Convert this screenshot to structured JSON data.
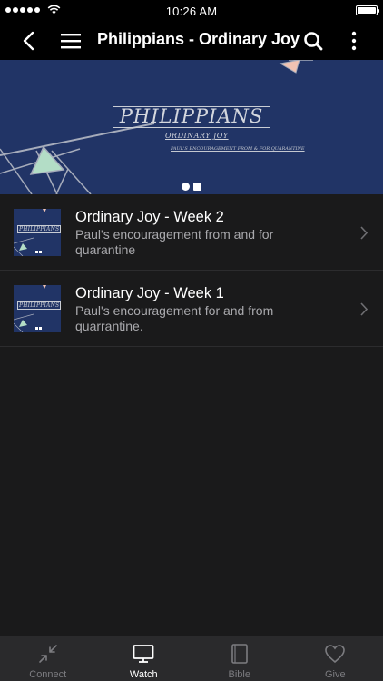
{
  "status_bar": {
    "time": "10:26 AM"
  },
  "nav": {
    "title": "Philippians - Ordinary Joy",
    "icons": [
      "back-icon",
      "menu-icon",
      "search-icon",
      "more-icon"
    ]
  },
  "banner": {
    "title": "PHILIPPIANS",
    "subtitle": "ORDINARY JOY",
    "tagline": "PAUL'S ENCOURAGEMENT FROM & FOR QUARANTINE",
    "background": "#213466"
  },
  "episodes": [
    {
      "title": "Ordinary Joy - Week 2",
      "description": "Paul's encouragement from and for quarantine",
      "thumb_label": "PHILIPPIANS"
    },
    {
      "title": "Ordinary Joy - Week 1",
      "description": "Paul's encouragement for and from quarrantine.",
      "thumb_label": "PHILIPPIANS"
    }
  ],
  "tabs": [
    {
      "label": "Connect",
      "icon": "connect-icon",
      "active": false
    },
    {
      "label": "Watch",
      "icon": "tv-icon",
      "active": true
    },
    {
      "label": "Bible",
      "icon": "book-icon",
      "active": false
    },
    {
      "label": "Give",
      "icon": "heart-icon",
      "active": false
    }
  ],
  "colors": {
    "background": "#1a1a1b",
    "tab_bar": "#2a2a2c",
    "active": "#ffffff",
    "inactive": "#7c7c80"
  }
}
